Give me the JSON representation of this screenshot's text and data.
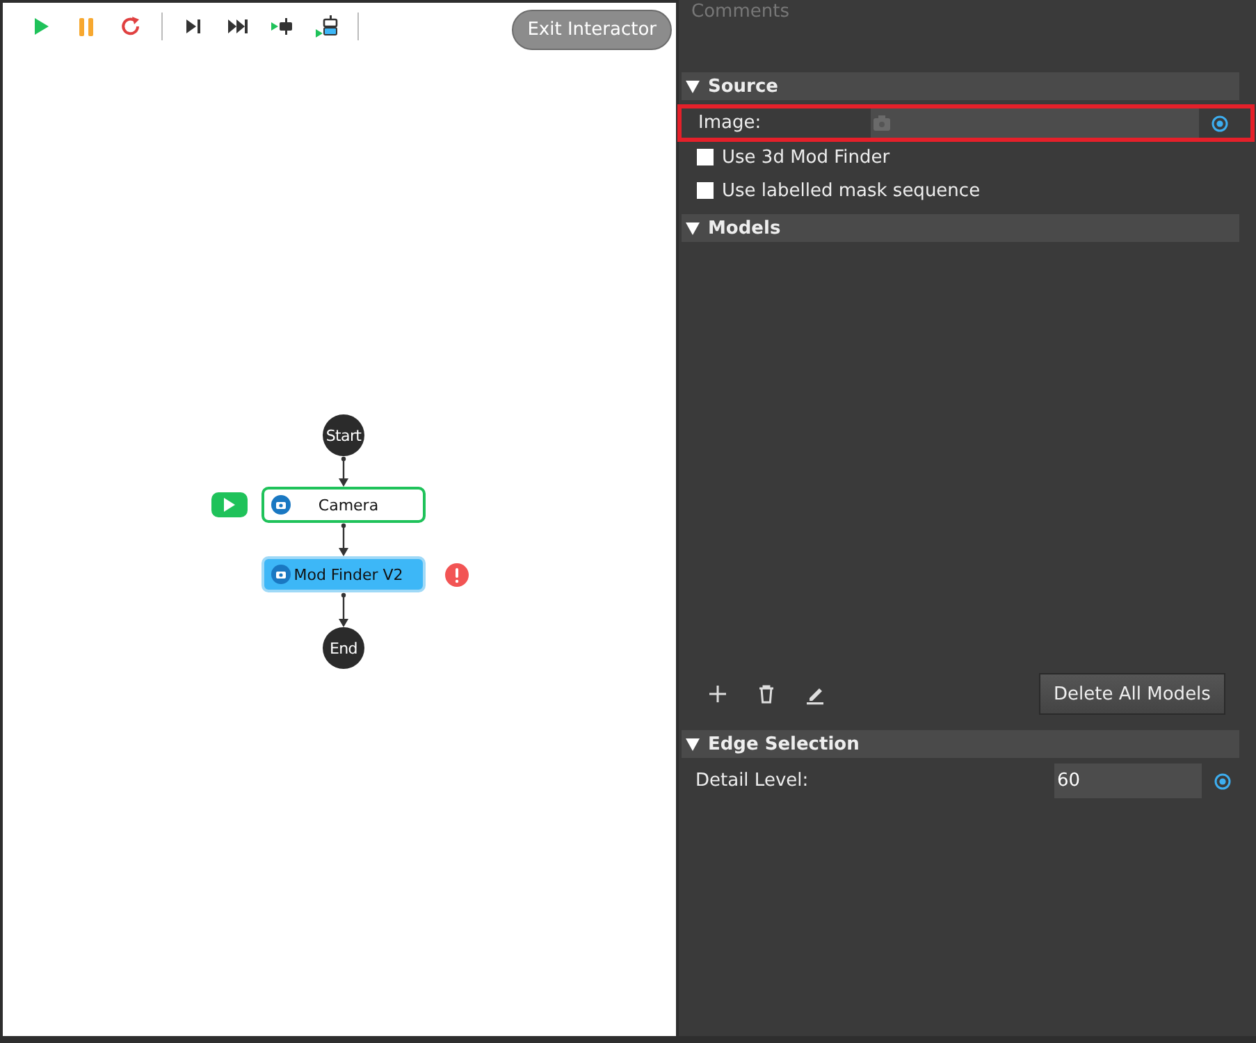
{
  "toolbar": {
    "exit_button": "Exit Interactor"
  },
  "flow": {
    "nodes": [
      {
        "kind": "terminal",
        "label": "Start"
      },
      {
        "kind": "step",
        "label": "Camera",
        "running": true,
        "selected": false,
        "error": false
      },
      {
        "kind": "step",
        "label": "Mod Finder V2",
        "running": false,
        "selected": true,
        "error": true
      },
      {
        "kind": "terminal",
        "label": "End"
      }
    ]
  },
  "panel": {
    "comments_label": "Comments",
    "sections": [
      {
        "title": "Source",
        "expanded": true,
        "rows": [
          {
            "kind": "image",
            "label": "Image:",
            "highlighted": true
          },
          {
            "kind": "checkbox",
            "label": "Use 3d Mod Finder",
            "checked": false
          },
          {
            "kind": "checkbox",
            "label": "Use labelled mask sequence",
            "checked": false
          }
        ]
      },
      {
        "title": "Models",
        "expanded": true,
        "rows": [
          {
            "kind": "list_tools",
            "button": "Delete All Models"
          }
        ]
      },
      {
        "title": "Edge Selection",
        "expanded": true,
        "rows": [
          {
            "kind": "number",
            "label": "Detail Level:",
            "value": "60"
          }
        ]
      }
    ]
  }
}
